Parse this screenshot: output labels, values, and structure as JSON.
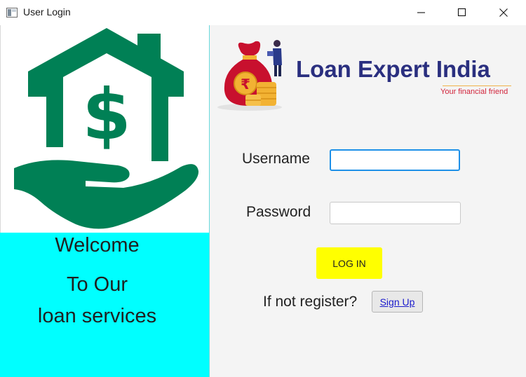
{
  "window": {
    "title": "User Login",
    "controls": {
      "minimize": "minimize-icon",
      "maximize": "maximize-icon",
      "close": "close-icon"
    }
  },
  "left_panel": {
    "illustration": "house-dollar-hand-icon",
    "welcome_line1": "Welcome",
    "welcome_line2": "To Our",
    "welcome_line3": "loan services"
  },
  "brand": {
    "name": "Loan Expert India",
    "tagline": "Your financial friend"
  },
  "form": {
    "username_label": "Username",
    "username_value": "",
    "password_label": "Password",
    "password_value": "",
    "login_label": "LOG IN",
    "register_prompt": "If not register?",
    "signup_label": "Sign Up"
  },
  "colors": {
    "left_accent": "#00ffff",
    "icon_green": "#008055",
    "login_button": "#ffff00",
    "brand_text": "#2a2f7f",
    "tagline_text": "#d1233a",
    "focus_border": "#1e90e8"
  }
}
